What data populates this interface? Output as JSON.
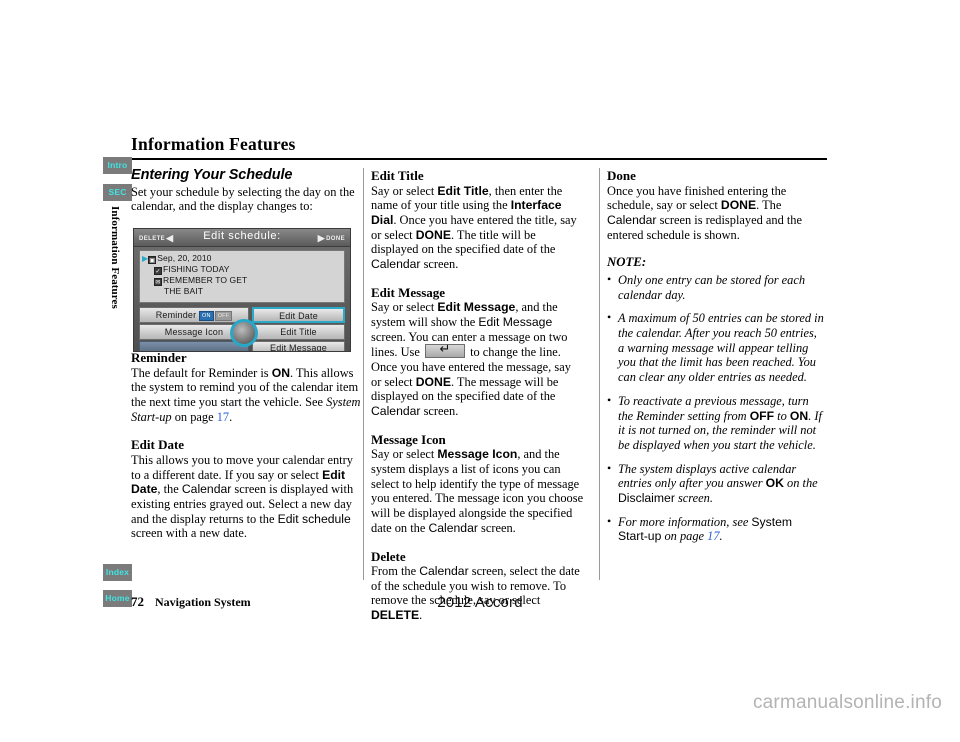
{
  "document": {
    "title": "Information Features",
    "side_label": "Information Features",
    "model": "2012 Accord",
    "watermark": "carmanualsonline.info"
  },
  "sidebar": {
    "tabs": [
      {
        "label": "Intro"
      },
      {
        "label": "SEC"
      },
      {
        "label": "Index"
      },
      {
        "label": "Home"
      }
    ]
  },
  "footer": {
    "page_number": "72",
    "section_label": "Navigation System"
  },
  "columns": {
    "left": {
      "heading": "Entering Your Schedule",
      "intro": "Set your schedule by selecting the day on the calendar, and the display changes to:",
      "sections": [
        {
          "heading": "Reminder",
          "p1_a": "The default for Reminder is ",
          "p1_b": "ON",
          "p1_c": ". This allows the system to remind you of the calendar item the next time you start the vehicle. See ",
          "p1_d": "System Start-up",
          "p1_e": " on page ",
          "p1_page": "17",
          "p1_f": "."
        },
        {
          "heading": "Edit Date",
          "p1_a": "This allows you to move your calendar entry to a different date. If you say or select ",
          "p1_b": "Edit Date",
          "p1_c": ", the ",
          "p1_d": "Calendar",
          "p1_e": " screen is displayed with existing entries grayed out. Select a new day and the display returns to the ",
          "p1_f": "Edit schedule",
          "p1_g": " screen with a new date."
        }
      ]
    },
    "middle": {
      "sections": [
        {
          "heading": "Edit Title",
          "a": "Say or select ",
          "b": "Edit Title",
          "c": ", then enter the name of your title using the ",
          "d": "Interface Dial",
          "e": ". Once you have entered the title, say or select ",
          "f": "DONE",
          "g": ". The title will be displayed on the specified date of the ",
          "h": "Calendar",
          "i": " screen."
        },
        {
          "heading": "Edit Message",
          "a": "Say or select ",
          "b": "Edit Message",
          "c": ", and the system will show the ",
          "d": "Edit Message",
          "e": " screen. You can enter a message on two lines. Use ",
          "icon": "enter-key-icon",
          "f": " to change the line. Once you have entered the message, say or select ",
          "g": "DONE",
          "h": ". The message will be displayed on the specified date of the ",
          "i": "Calendar",
          "j": " screen."
        },
        {
          "heading": "Message Icon",
          "a": "Say or select ",
          "b": "Message Icon",
          "c": ", and the system displays a list of icons you can select to help identify the type of message you entered. The message icon you choose will be displayed alongside the specified date on the ",
          "d": "Calendar",
          "e": " screen."
        },
        {
          "heading": "Delete",
          "a": "From the ",
          "b": "Calendar",
          "c": " screen, select the date of the schedule you wish to remove. To remove the schedule, say or select ",
          "d": "DELETE",
          "e": "."
        }
      ]
    },
    "right": {
      "section": {
        "heading": "Done",
        "a": "Once you have finished entering the schedule, say or select ",
        "b": "DONE",
        "c": ". The ",
        "d": "Calendar",
        "e": " screen is redisplayed and the entered schedule is shown."
      },
      "note_title": "NOTE:",
      "notes": [
        {
          "a": "Only one entry can be stored for each calendar day."
        },
        {
          "a": "A maximum of 50 entries can be stored in the calendar. After you reach 50 entries, a warning message will appear telling you that the limit has been reached. You can clear any older entries as needed."
        },
        {
          "a": "To reactivate a previous message, turn the Reminder setting from ",
          "b": "OFF",
          "c": " to ",
          "d": "ON",
          "e": ". If it is not turned on, the reminder will not be displayed when you start the vehicle."
        },
        {
          "a": "The system displays active calendar entries only after you answer ",
          "b": "OK",
          "c": " on the ",
          "d": "Disclaimer",
          "e": " screen."
        },
        {
          "a": "For more information, see ",
          "b": "System Start-up",
          "c": " on page ",
          "page": "17",
          "d": "."
        }
      ]
    }
  },
  "nav_screen": {
    "title": "Edit schedule:",
    "left_button": "DELETE",
    "right_button": "DONE",
    "list": [
      {
        "icon": "calendar-icon",
        "text": "Sep, 20, 2010"
      },
      {
        "icon": "check-icon",
        "text": "FISHING TODAY"
      },
      {
        "icon": "message-icon",
        "text": "REMEMBER TO GET"
      },
      {
        "icon": "",
        "text": "THE BAIT"
      }
    ],
    "buttons": {
      "reminder": "Reminder",
      "reminder_on": "ON",
      "reminder_off": "OFF",
      "message_icon": "Message Icon",
      "edit_date": "Edit Date",
      "edit_title": "Edit Title",
      "edit_message": "Edit Message"
    }
  },
  "colors": {
    "accent_cyan": "#29a7c8",
    "tab_bg": "#7b7b7b",
    "tab_text": "#3fe4e4",
    "link": "#2b5fd9"
  }
}
